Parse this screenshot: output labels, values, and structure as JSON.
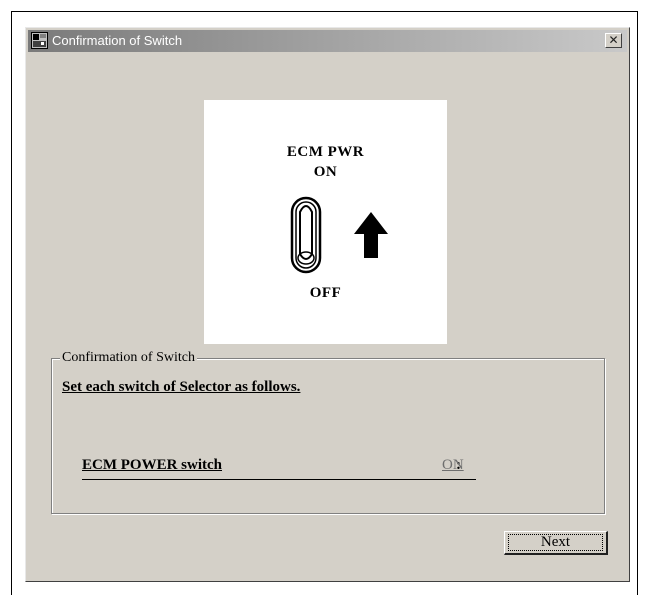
{
  "window": {
    "title": "Confirmation of Switch",
    "close_glyph": "✕"
  },
  "illustration": {
    "label_top": "ECM PWR",
    "label_on": "ON",
    "label_off": "OFF"
  },
  "group": {
    "legend": "Confirmation of Switch",
    "instruction": "Set each switch of Selector as follows.",
    "switch_label": "ECM POWER switch",
    "separator": ":",
    "switch_value": "ON"
  },
  "buttons": {
    "next_label": "Next"
  },
  "icons": {
    "app": "app-icon",
    "toggle": "toggle-switch-icon",
    "arrow": "up-arrow-icon"
  }
}
